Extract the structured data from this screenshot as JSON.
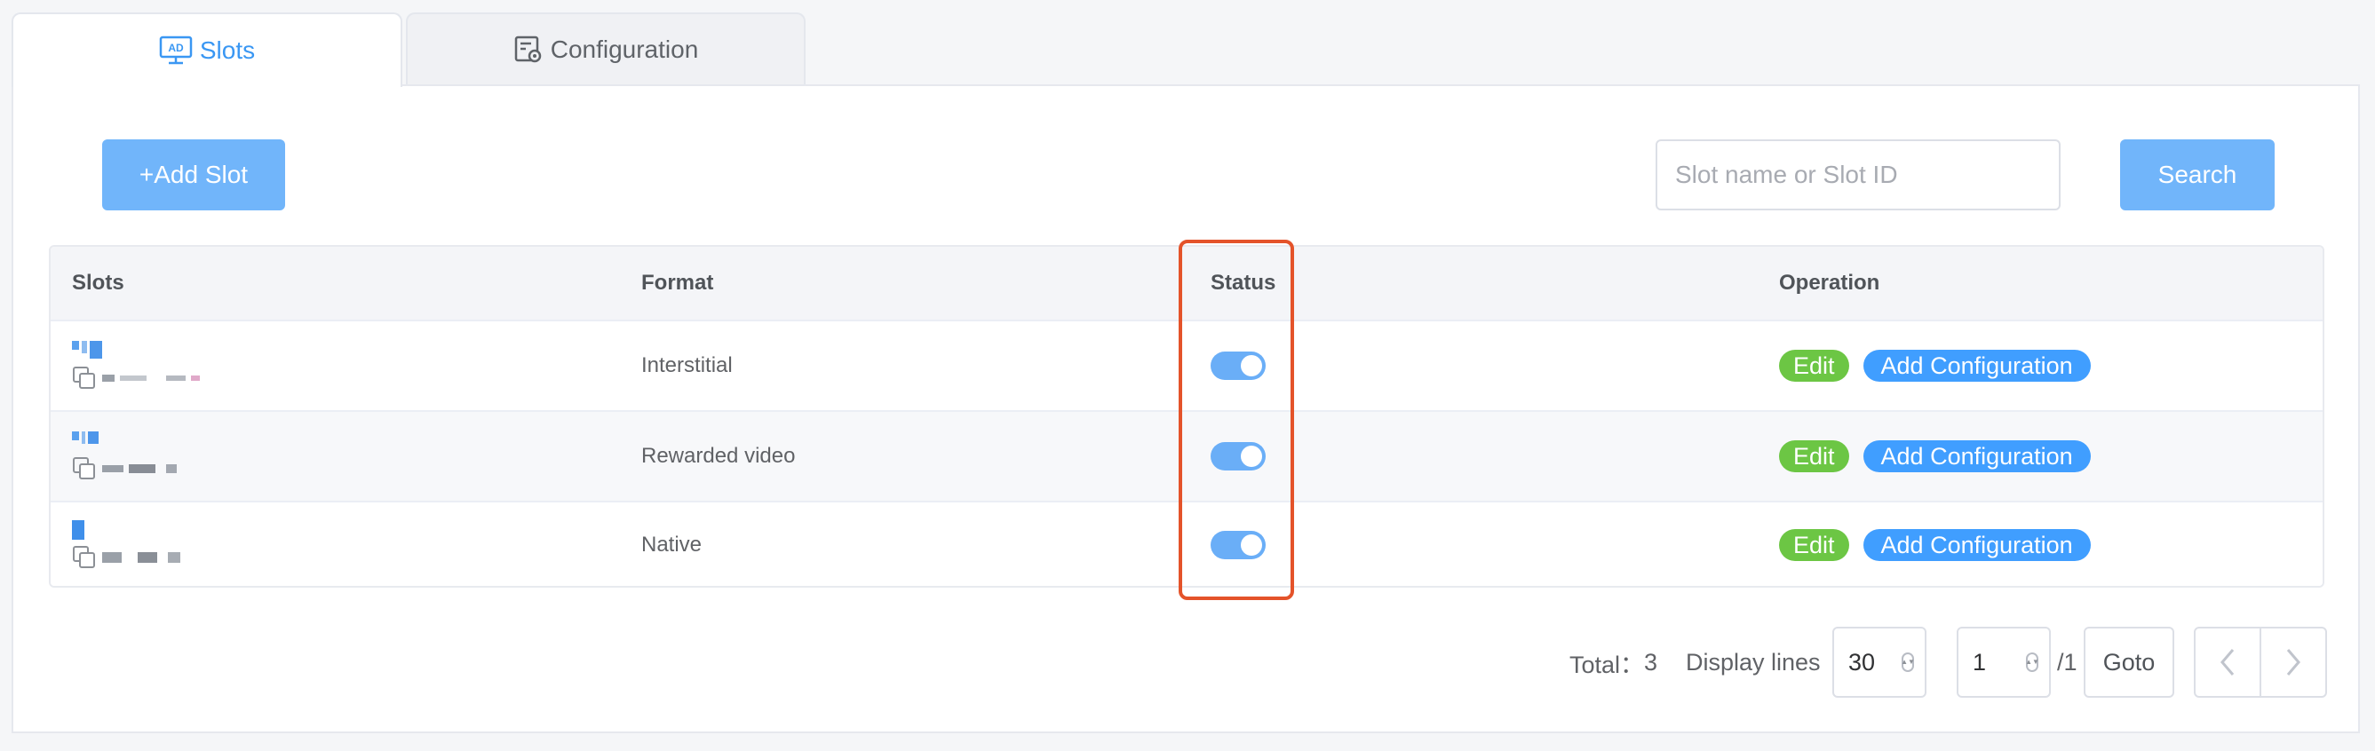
{
  "tabs": [
    {
      "label": "Slots",
      "icon": "ad-display-icon",
      "active": true
    },
    {
      "label": "Configuration",
      "icon": "settings-sheet-icon",
      "active": false
    }
  ],
  "toolbar": {
    "add_label": "+Add Slot",
    "search_placeholder": "Slot name or Slot ID",
    "search_value": "",
    "search_label": "Search"
  },
  "table": {
    "headers": [
      "Slots",
      "Format",
      "Status",
      "Operation"
    ],
    "rows": [
      {
        "format": "Interstitial",
        "status_on": true,
        "edit": "Edit",
        "config": "Add Configuration"
      },
      {
        "format": "Rewarded video",
        "status_on": true,
        "edit": "Edit",
        "config": "Add Configuration"
      },
      {
        "format": "Native",
        "status_on": true,
        "edit": "Edit",
        "config": "Add Configuration"
      }
    ]
  },
  "pagination": {
    "total_label": "Total：",
    "total": "3",
    "lines_label": "Display lines",
    "lines_value": "30",
    "page_value": "1",
    "page_total": "/1",
    "goto_label": "Goto"
  },
  "colors": {
    "accent": "#409eff",
    "button": "#71b5fa",
    "edit": "#6cc644",
    "highlight": "#e4532a"
  }
}
